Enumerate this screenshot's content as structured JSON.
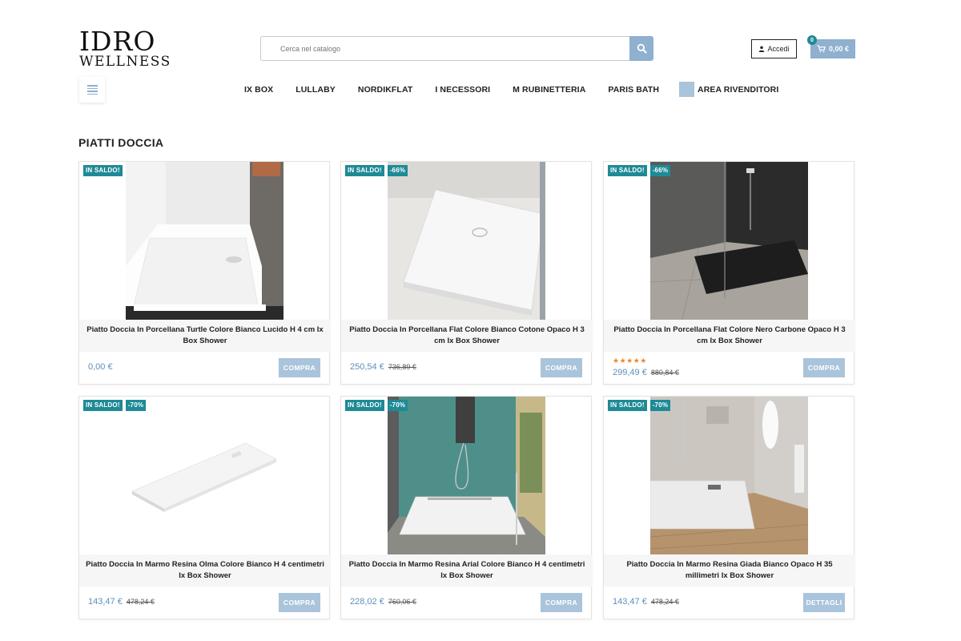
{
  "brand": {
    "line1": "IDRO",
    "line2": "WELLNESS"
  },
  "search": {
    "placeholder": "Cerca nel catalogo"
  },
  "account": {
    "login_label": "Accedi"
  },
  "cart": {
    "count": "0",
    "total": "0,00 €"
  },
  "nav": {
    "items": [
      {
        "label": "IX BOX"
      },
      {
        "label": "LULLABY"
      },
      {
        "label": "NORDIKFLAT"
      },
      {
        "label": "I NECESSORI"
      },
      {
        "label": "M RUBINETTERIA"
      },
      {
        "label": "PARIS BATH"
      },
      {
        "label": "AREA RIVENDITORI"
      }
    ]
  },
  "section": {
    "title": "PIATTI DOCCIA"
  },
  "products": [
    {
      "badges": [
        "IN SALDO!"
      ],
      "name": "Piatto Doccia In Porcellana Turtle Colore Bianco Lucido H 4 cm Ix Box Shower",
      "price": "0,00 €",
      "old_price": "",
      "stars": "",
      "rating": null,
      "button": "COMPRA"
    },
    {
      "badges": [
        "IN SALDO!",
        "-66%"
      ],
      "name": "Piatto Doccia In Porcellana Flat Colore Bianco Cotone Opaco H 3 cm Ix Box Shower",
      "price": "250,54 €",
      "old_price": "736,89 €",
      "stars": "",
      "rating": null,
      "button": "COMPRA"
    },
    {
      "badges": [
        "IN SALDO!",
        "-66%"
      ],
      "name": "Piatto Doccia In Porcellana Flat Colore Nero Carbone Opaco H 3 cm Ix Box Shower",
      "price": "299,49 €",
      "old_price": "880,84 €",
      "stars": "★★★★★",
      "rating": 5,
      "button": "COMPRA"
    },
    {
      "badges": [
        "IN SALDO!",
        "-70%"
      ],
      "name": "Piatto Doccia In Marmo Resina Olma Colore Bianco H 4 centimetri Ix Box Shower",
      "price": "143,47 €",
      "old_price": "478,24 €",
      "stars": "",
      "rating": null,
      "button": "COMPRA"
    },
    {
      "badges": [
        "IN SALDO!",
        "-70%"
      ],
      "name": "Piatto Doccia In Marmo Resina Arial Colore Bianco H 4 centimetri Ix Box Shower",
      "price": "228,02 €",
      "old_price": "760,06 €",
      "stars": "",
      "rating": null,
      "button": "COMPRA"
    },
    {
      "badges": [
        "IN SALDO!",
        "-70%"
      ],
      "name": "Piatto Doccia In Marmo Resina Giada Bianco Opaco H 35 millimetri Ix Box Shower",
      "price": "143,47 €",
      "old_price": "478,24 €",
      "stars": "",
      "rating": null,
      "button": "DETTAGLI"
    }
  ],
  "colors": {
    "accent": "#8fb0cf",
    "button": "#a9c4db",
    "badge": "#1e8a96",
    "price": "#5b8fbe",
    "stars": "#e8892b"
  }
}
